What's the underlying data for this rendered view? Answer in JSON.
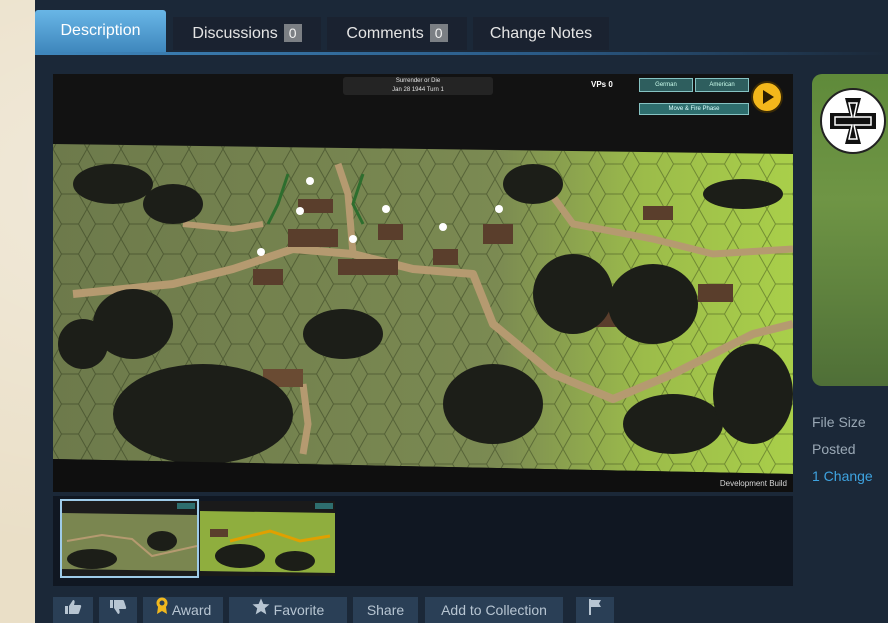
{
  "tabs": [
    {
      "label": "Description"
    },
    {
      "label": "Discussions",
      "count": "0"
    },
    {
      "label": "Comments",
      "count": "0"
    },
    {
      "label": "Change Notes"
    }
  ],
  "screenshot": {
    "hud_title": "Surrender or Die",
    "hud_date": "Jan 28 1944 Turn 1",
    "vps_label": "VPs 0",
    "faction_a": "German",
    "faction_b": "American",
    "phase": "Move & Fire Phase",
    "watermark": "Development Build"
  },
  "meta": {
    "file_size_label": "File Size",
    "posted_label": "Posted",
    "changes_link": "1 Change"
  },
  "actions": {
    "award": "Award",
    "favorite": "Favorite",
    "share": "Share",
    "add_to_collection": "Add to Collection"
  },
  "colors": {
    "panel_bg": "#1b2838",
    "tab_active": "#4b9bd1",
    "link": "#3ea3e0",
    "award_gold": "#f0b81e"
  },
  "icons": [
    "thumbs-up-icon",
    "thumbs-down-icon",
    "award-icon",
    "star-icon",
    "flag-icon",
    "play-icon",
    "iron-cross-icon"
  ]
}
